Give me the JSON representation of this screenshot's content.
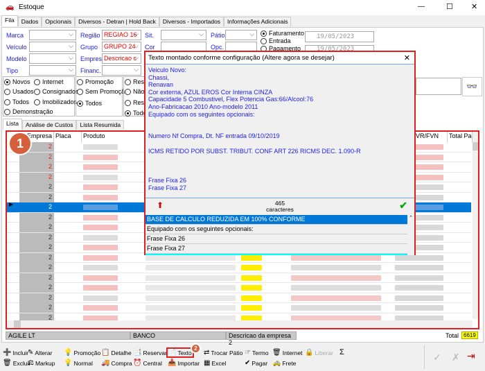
{
  "window": {
    "title": "Estoque",
    "minimize": "—",
    "maximize": "☐",
    "close": "✕"
  },
  "tabs": [
    "Fila",
    "Dados",
    "Opcionais",
    "Diversos - Detran | Hold Back",
    "Diversos - Importados",
    "Informações Adicionais"
  ],
  "filters": {
    "marca": {
      "label": "Marca",
      "value": ""
    },
    "veiculo": {
      "label": "Veículo",
      "value": ""
    },
    "modelo": {
      "label": "Modelo",
      "value": ""
    },
    "tipo": {
      "label": "Tipo",
      "value": ""
    },
    "regiao": {
      "label": "Região",
      "value": "REGIAO 16"
    },
    "grupo": {
      "label": "Grupo",
      "value": "GRUPO 24"
    },
    "empresa": {
      "label": "Empresa",
      "value": "Descricao c"
    },
    "financ": {
      "label": "Financ.",
      "value": ""
    },
    "sit": {
      "label": "Sit.",
      "value": ""
    },
    "cor": {
      "label": "Cor",
      "value": ""
    },
    "patio": {
      "label": "Pátio",
      "value": ""
    },
    "opc": {
      "label": "Opc.",
      "value": ""
    }
  },
  "date_radios": [
    {
      "label": "Faturamento",
      "checked": true
    },
    {
      "label": "Entrada",
      "checked": false
    },
    {
      "label": "Pagamento",
      "checked": false
    }
  ],
  "dates": [
    "19/05/2023",
    "19/05/2023"
  ],
  "status_radios": [
    {
      "label": "Novos",
      "checked": true
    },
    {
      "label": "Internet",
      "checked": false
    },
    {
      "label": "Usados",
      "checked": false
    },
    {
      "label": "Consignados",
      "checked": false
    },
    {
      "label": "Todos",
      "checked": false
    },
    {
      "label": "Imobilizados",
      "checked": false
    },
    {
      "label": "Demonstração",
      "checked": false
    }
  ],
  "promo_radios": [
    {
      "label": "Promoção",
      "checked": false
    },
    {
      "label": "Sem Promoção",
      "checked": false
    },
    {
      "label": "Todos",
      "checked": true
    }
  ],
  "reserva_radios": [
    {
      "label": "Rese",
      "checked": false
    },
    {
      "label": "Não",
      "checked": false
    },
    {
      "label": "Rese",
      "checked": false
    },
    {
      "label": "Todo",
      "checked": true
    }
  ],
  "list_tabs": [
    "Lista",
    "Análise de Custos",
    "Lista Resumida"
  ],
  "grid": {
    "columns": [
      "Empresa",
      "Placa",
      "Produto",
      "VR/FVN",
      "Total Pag"
    ],
    "empresa_values": [
      "2",
      "2",
      "2",
      "2",
      "2",
      "2",
      "2",
      "2",
      "2",
      "2",
      "2",
      "2",
      "2",
      "2",
      "2",
      "2",
      "2",
      "2"
    ],
    "selected_row": 6
  },
  "dialog": {
    "title": "Texto montado conforme configuração (Altere agora se desejar)",
    "lines": [
      "Veiculo Novo:",
      "Chassi,",
      "Renavan",
      "Cor externa,  AZUL EROS   Cor Interna CINZA",
      "Capacidade 5   Combustivel,  Flex   Potencia Gas:66/Alcool:76",
      "Ano-Fabricacao 2010   Ano-modelo 2011",
      "Equipado com os seguintes opcionais:",
      "",
      "",
      "Numero Nf Compra,          Dt. NF entrada 09/10/2019",
      "",
      "ICMS RETIDO POR SUBST. TRIBUT. CONF ART 226 RICMS DEC. 1.090-R",
      "",
      "",
      "",
      "Frase Fixa 26",
      "Frase Fixa 27"
    ],
    "char_count": "465",
    "char_label": "caracteres",
    "phrases": [
      "BASE DE CALCULO REDUZIDA EM 100% CONFORME",
      "Equipado com os seguintes opcionais:",
      "Frase Fixa 26",
      "Frase Fixa 27",
      ""
    ]
  },
  "statusbar": {
    "company": "AGILE LT",
    "bank": "BANCO",
    "empresa_desc": "Descricao da empresa 2",
    "total_label": "Total",
    "total_value": "6619"
  },
  "toolbar": {
    "row1": [
      "Incluir",
      "Alterar",
      "Promoção",
      "Detalhe",
      "Reservar",
      "Texto",
      "Trocar Pátio",
      "Termo",
      "Internet",
      "Liberar"
    ],
    "row2": [
      "Excluir",
      "Markup",
      "Normal",
      "Compra",
      "Central",
      "Importar",
      "Excel",
      "Pagar",
      "Frete"
    ]
  },
  "annotations": [
    "1",
    "2"
  ],
  "colors": {
    "highlight": "#e02020",
    "selection": "#0078d7",
    "annotation": "#d65f3c",
    "dialog_text": "#2020ee",
    "cyan_row": "#00ffff",
    "total_bg": "#ffff00"
  }
}
